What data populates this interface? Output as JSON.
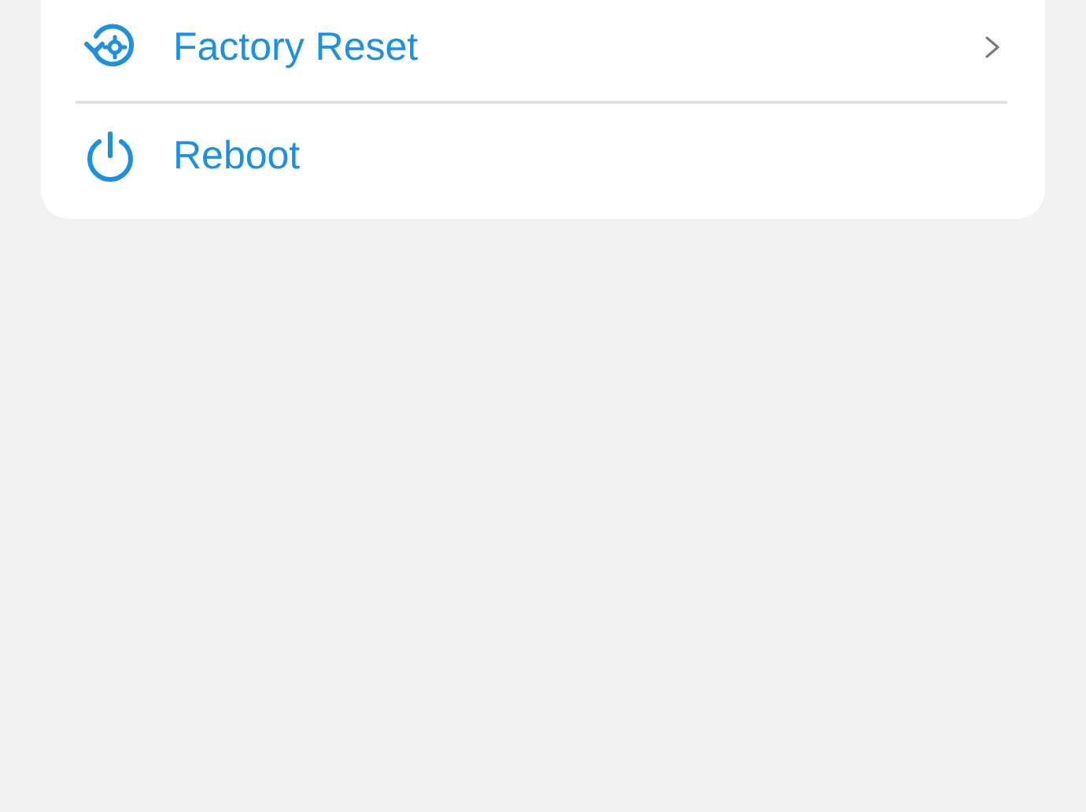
{
  "menu": {
    "items": [
      {
        "label": "Factory Reset",
        "kind": "submenu"
      },
      {
        "label": "Reboot",
        "kind": "action"
      }
    ]
  }
}
